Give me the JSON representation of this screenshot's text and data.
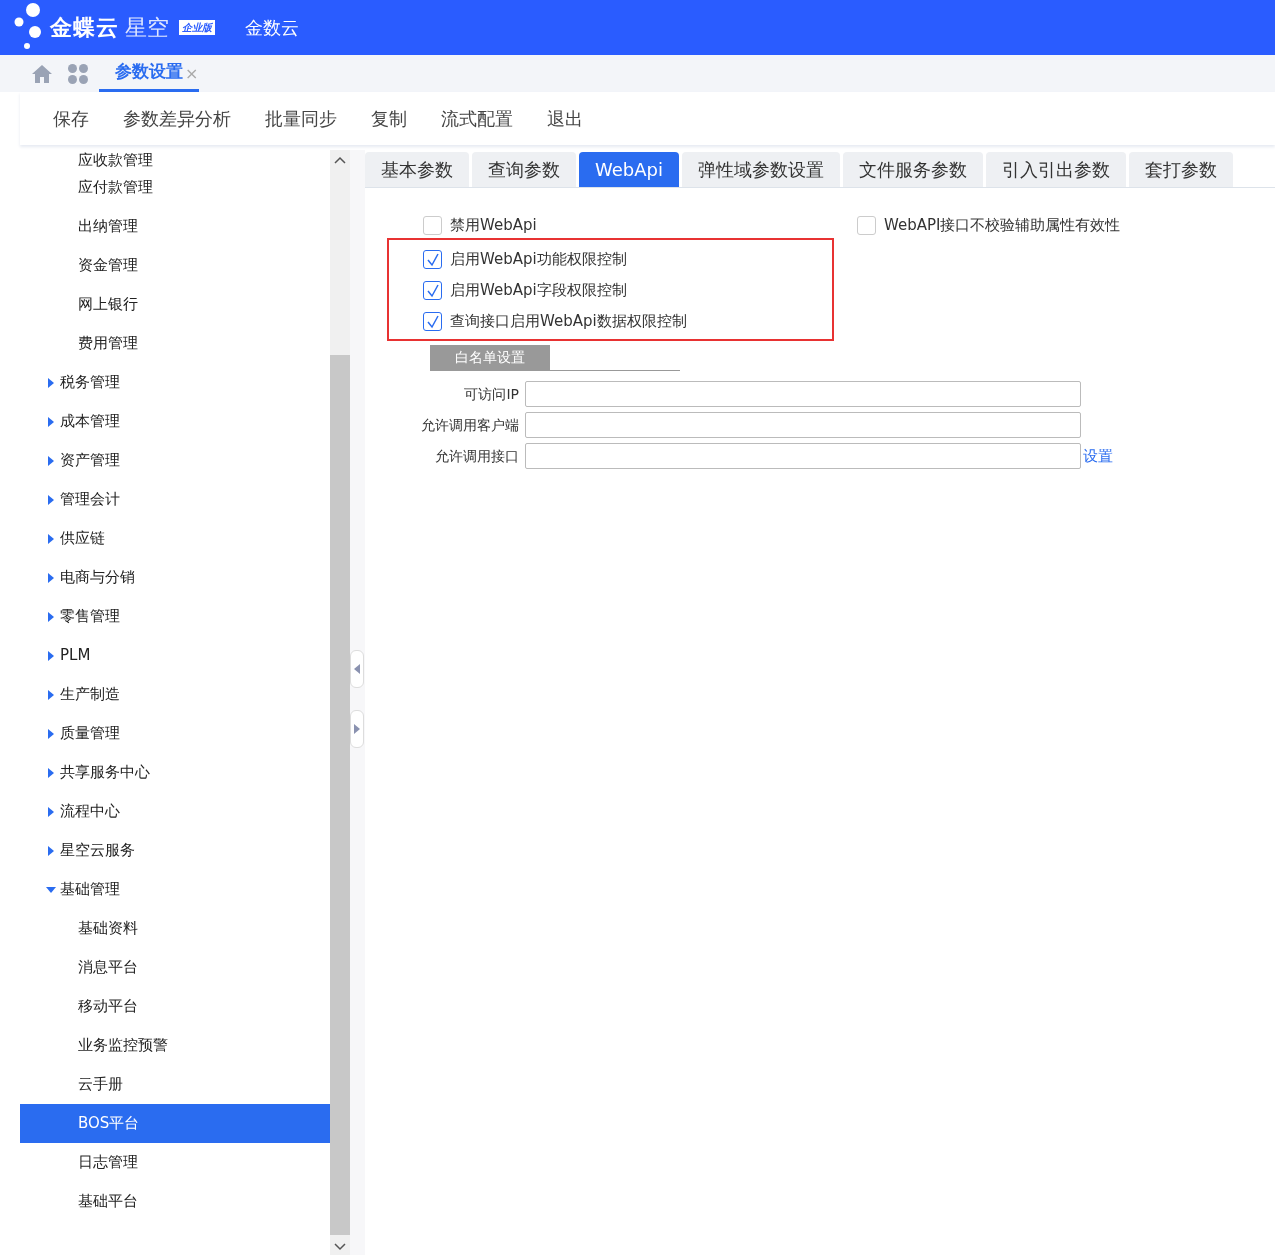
{
  "header": {
    "logo_text": "金蝶云",
    "logo_subtext": "星空",
    "edition_badge": "企业版",
    "app_title": "金数云"
  },
  "page_tabs": [
    {
      "label": "参数设置",
      "selected": true,
      "close_glyph": "×"
    }
  ],
  "toolbar": [
    "保存",
    "参数差异分析",
    "批量同步",
    "复制",
    "流式配置",
    "退出"
  ],
  "sidebar": {
    "items_continued": [
      {
        "label": "应收款管理",
        "selected": false
      },
      {
        "label": "应付款管理",
        "selected": false
      },
      {
        "label": "出纳管理",
        "selected": false
      },
      {
        "label": "资金管理",
        "selected": false
      },
      {
        "label": "网上银行",
        "selected": false
      },
      {
        "label": "费用管理",
        "selected": false
      }
    ],
    "items": [
      {
        "label": "税务管理",
        "expanded": false,
        "selected": false
      },
      {
        "label": "成本管理",
        "expanded": false,
        "selected": false
      },
      {
        "label": "资产管理",
        "expanded": false,
        "selected": false
      },
      {
        "label": "管理会计",
        "expanded": false,
        "selected": false
      },
      {
        "label": "供应链",
        "expanded": false,
        "selected": false
      },
      {
        "label": "电商与分销",
        "expanded": false,
        "selected": false
      },
      {
        "label": "零售管理",
        "expanded": false,
        "selected": false
      },
      {
        "label": "PLM",
        "expanded": false,
        "selected": false
      },
      {
        "label": "生产制造",
        "expanded": false,
        "selected": false
      },
      {
        "label": "质量管理",
        "expanded": false,
        "selected": false
      },
      {
        "label": "共享服务中心",
        "expanded": false,
        "selected": false
      },
      {
        "label": "流程中心",
        "expanded": false,
        "selected": false
      },
      {
        "label": "星空云服务",
        "expanded": false,
        "selected": false
      },
      {
        "label": "基础管理",
        "expanded": true,
        "selected": false,
        "children": [
          {
            "label": "基础资料",
            "selected": false
          },
          {
            "label": "消息平台",
            "selected": false
          },
          {
            "label": "移动平台",
            "selected": false
          },
          {
            "label": "业务监控预警",
            "selected": false
          },
          {
            "label": "云手册",
            "selected": false
          },
          {
            "label": "BOS平台",
            "selected": true
          },
          {
            "label": "日志管理",
            "selected": false
          },
          {
            "label": "基础平台",
            "selected": false
          }
        ]
      }
    ]
  },
  "param_tabs": [
    {
      "label": "基本参数",
      "selected": false
    },
    {
      "label": "查询参数",
      "selected": false
    },
    {
      "label": "WebApi",
      "selected": true
    },
    {
      "label": "弹性域参数设置",
      "selected": false
    },
    {
      "label": "文件服务参数",
      "selected": false
    },
    {
      "label": "引入引出参数",
      "selected": false
    },
    {
      "label": "套打参数",
      "selected": false
    }
  ],
  "options_left": [
    {
      "label": "禁用WebApi",
      "checked": false,
      "highlighted": false
    },
    {
      "label": "启用WebApi功能权限控制",
      "checked": true,
      "highlighted": true
    },
    {
      "label": "启用WebApi字段权限控制",
      "checked": true,
      "highlighted": true
    },
    {
      "label": "查询接口启用WebApi数据权限控制",
      "checked": true,
      "highlighted": true
    }
  ],
  "options_right": [
    {
      "label": "WebAPI接口不校验辅助属性有效性",
      "checked": false
    }
  ],
  "whitelist": {
    "title": "白名单设置",
    "fields": [
      {
        "label": "可访问IP"
      },
      {
        "label": "允许调用客户端"
      },
      {
        "label": "允许调用接口",
        "link": "设置"
      }
    ]
  }
}
